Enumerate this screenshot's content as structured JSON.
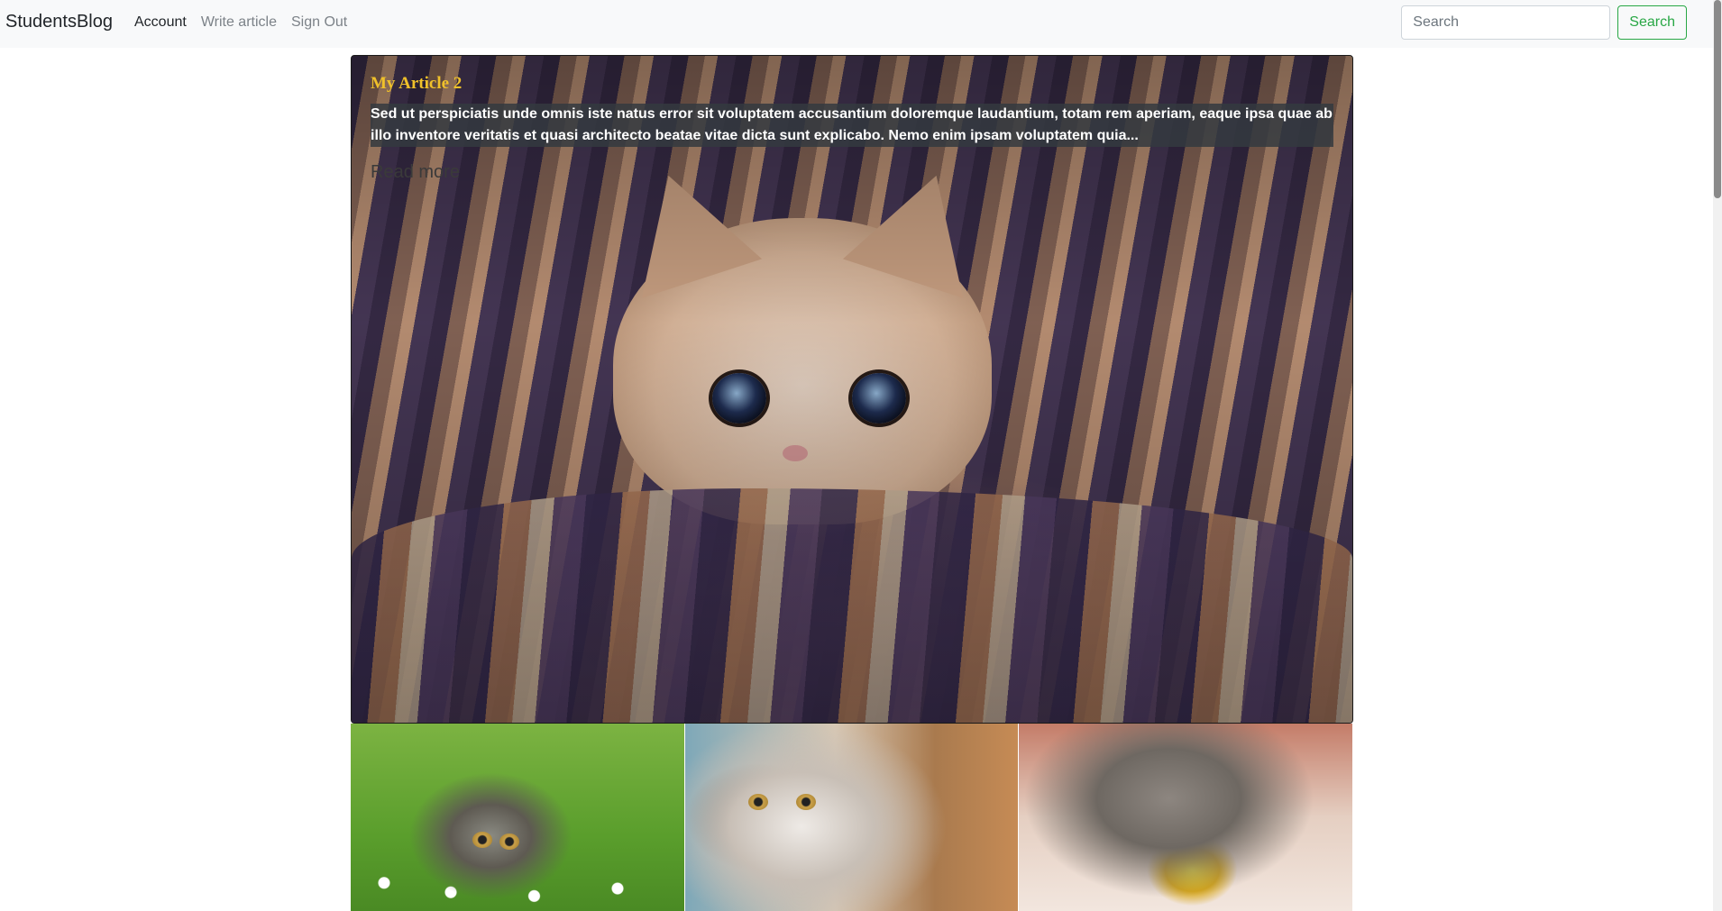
{
  "navbar": {
    "brand": "StudentsBlog",
    "links": [
      {
        "label": "Account",
        "active": true
      },
      {
        "label": "Write article",
        "active": false
      },
      {
        "label": "Sign Out",
        "active": false
      }
    ],
    "search": {
      "placeholder": "Search",
      "value": "",
      "button_label": "Search"
    }
  },
  "hero": {
    "title": "My Article 2",
    "excerpt": "Sed ut perspiciatis unde omnis iste natus error sit voluptatem accusantium doloremque laudantium, totam rem aperiam, eaque ipsa quae ab illo inventore veritatis et quasi architecto beatae vitae dicta sunt explicabo. Nemo enim ipsam voluptatem quia...",
    "read_more": "Read more"
  },
  "thumbnails": [
    {
      "subject": "kitten-in-grass"
    },
    {
      "subject": "calico-cat"
    },
    {
      "subject": "gray-cat-with-cupcake"
    }
  ],
  "colors": {
    "title_accent": "#f0c12a",
    "search_button": "#28a745",
    "navbar_bg": "#f8f9fa"
  }
}
